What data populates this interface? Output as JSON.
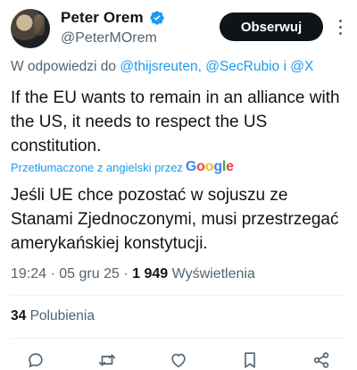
{
  "author": {
    "display_name": "Peter Orem",
    "handle": "@PeterMOrem",
    "verified": true
  },
  "follow_button_label": "Obserwuj",
  "more_icon": "more-vertical-icon",
  "reply_context": {
    "prefix": "W odpowiedzi do ",
    "mentions": [
      "@thijsreuten",
      "@SecRubio",
      "@X"
    ],
    "separator": ", ",
    "conjunction": " i "
  },
  "tweet": {
    "text": "If the EU wants to remain in an alliance with the US, it needs to respect the US constitution."
  },
  "translation": {
    "label": "Przetłumaczone z angielski przez",
    "provider": "Google",
    "text": "Jeśli UE chce pozostać w sojuszu ze Stanami Zjednoczonymi, musi przestrzegać amerykańskiej konstytucji."
  },
  "meta": {
    "time": "19:24",
    "date": "05 gru 25",
    "dot": "·",
    "views_count": "1 949",
    "views_label": "Wyświetlenia"
  },
  "engagement": {
    "likes_count": "34",
    "likes_label": "Polubienia"
  },
  "actions": [
    {
      "icon": "reply-icon"
    },
    {
      "icon": "retweet-icon"
    },
    {
      "icon": "like-icon"
    },
    {
      "icon": "bookmark-icon"
    },
    {
      "icon": "share-icon"
    }
  ],
  "colors": {
    "accent": "#1d9bf0",
    "text": "#0f1419",
    "secondary": "#536471",
    "button_bg": "#0f1419"
  }
}
